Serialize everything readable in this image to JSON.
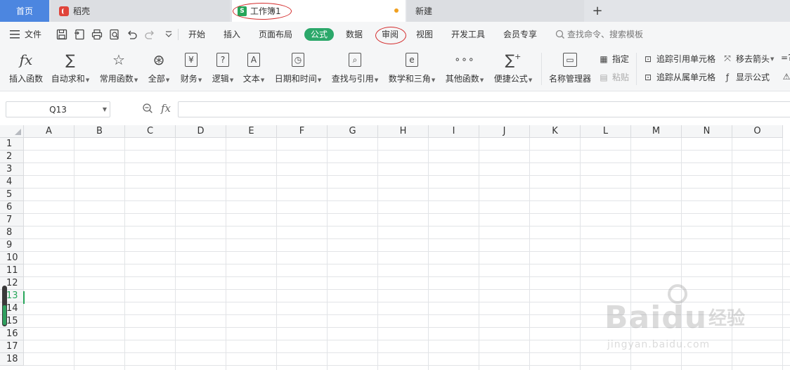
{
  "tabs": {
    "home": "首页",
    "daoke": "稻壳",
    "workbook": "工作簿1",
    "new": "新建",
    "add": "+"
  },
  "menu": {
    "file": "文件",
    "items": [
      "开始",
      "插入",
      "页面布局",
      "公式",
      "数据",
      "审阅",
      "视图",
      "开发工具",
      "会员专享"
    ],
    "active": "公式",
    "search_placeholder": "查找命令、搜索模板"
  },
  "ribbon": {
    "insert_function": "插入函数",
    "autosum": "自动求和",
    "common_functions": "常用函数",
    "all": "全部",
    "financial": "财务",
    "logical": "逻辑",
    "text": "文本",
    "datetime": "日期和时间",
    "lookup": "查找与引用",
    "math": "数学和三角",
    "other_functions": "其他函数",
    "quick_formula": "便捷公式",
    "name_manager": "名称管理器",
    "specify": "指定",
    "paste": "粘贴",
    "trace_precedents": "追踪引用单元格",
    "trace_dependents": "追踪从属单元格",
    "remove_arrows": "移去箭头",
    "show_formulas": "显示公式",
    "eq_fragment": "=?"
  },
  "formula_bar": {
    "name_box": "Q13",
    "fx": "fx",
    "value": ""
  },
  "columns": [
    "A",
    "B",
    "C",
    "D",
    "E",
    "F",
    "G",
    "H",
    "I",
    "J",
    "K",
    "L",
    "M",
    "N",
    "O"
  ],
  "rows": [
    "1",
    "2",
    "3",
    "4",
    "5",
    "6",
    "7",
    "8",
    "9",
    "10",
    "11",
    "12",
    "13",
    "14",
    "15",
    "16",
    "17",
    "18"
  ],
  "active_row": "13",
  "watermark": {
    "brand": "Baidu",
    "cn": "经验",
    "url": "jingyan.baidu.com"
  },
  "colors": {
    "accent_green": "#27a65a",
    "home_tab_blue": "#4c86e0",
    "annotation_red": "#d42c2c",
    "modified_dot": "#f0a020"
  }
}
